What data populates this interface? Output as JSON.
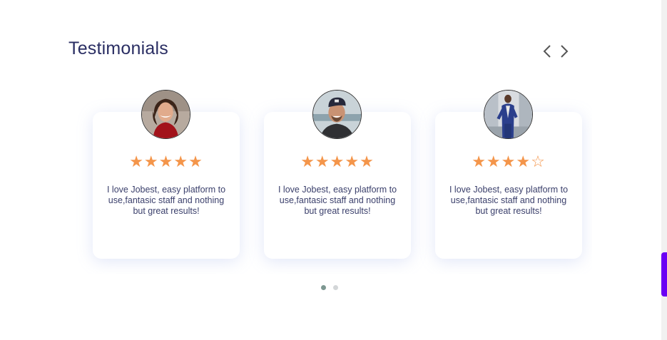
{
  "section": {
    "title": "Testimonials"
  },
  "navigation": {
    "prev_icon": "chevron-left-icon",
    "next_icon": "chevron-right-icon"
  },
  "testimonials": [
    {
      "avatar": "woman-smiling-portrait",
      "rating": 5,
      "stars": "★★★★★",
      "text": "I love Jobest, easy platform to use,fantasic staff and nothing but great results!"
    },
    {
      "avatar": "man-in-cap-portrait",
      "rating": 5,
      "stars": "★★★★★",
      "text": "I love Jobest, easy platform to use,fantasic staff and nothing but great results!"
    },
    {
      "avatar": "man-in-blue-suit-portrait",
      "rating": 4,
      "stars": "★★★★☆",
      "text": "I love Jobest, easy platform to use,fantasic staff and nothing but great results!"
    }
  ],
  "pagination": {
    "pages": 2,
    "active": 1
  },
  "colors": {
    "title": "#2a2e63",
    "star": "#f4954a",
    "dot_active": "#7d9791",
    "dot_inactive": "#d3d6d8",
    "scrollbar": "#6a00f4"
  }
}
